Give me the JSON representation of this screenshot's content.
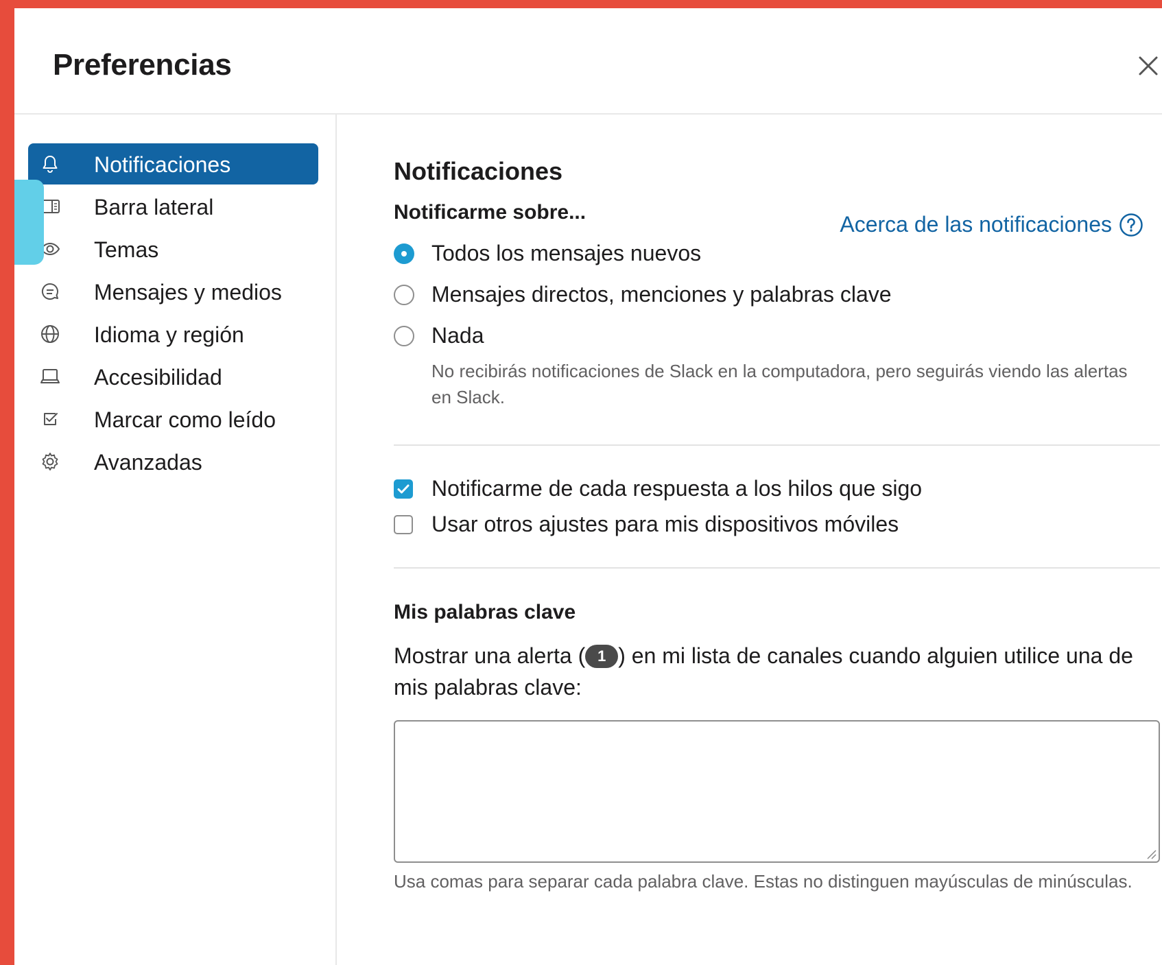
{
  "dialog": {
    "title": "Preferencias"
  },
  "sidebar": {
    "items": [
      {
        "label": "Notificaciones",
        "icon": "bell-icon",
        "active": true
      },
      {
        "label": "Barra lateral",
        "icon": "sidebar-icon",
        "active": false
      },
      {
        "label": "Temas",
        "icon": "eye-icon",
        "active": false
      },
      {
        "label": "Mensajes y medios",
        "icon": "message-icon",
        "active": false
      },
      {
        "label": "Idioma y región",
        "icon": "globe-icon",
        "active": false
      },
      {
        "label": "Accesibilidad",
        "icon": "laptop-icon",
        "active": false
      },
      {
        "label": "Marcar como leído",
        "icon": "check-square-icon",
        "active": false
      },
      {
        "label": "Avanzadas",
        "icon": "gear-icon",
        "active": false
      }
    ]
  },
  "main": {
    "section_title": "Notificaciones",
    "notify_heading": "Notificarme sobre...",
    "about_link": "Acerca de las notificaciones",
    "radio_options": [
      {
        "label": "Todos los mensajes nuevos",
        "checked": true
      },
      {
        "label": "Mensajes directos, menciones y palabras clave",
        "checked": false
      },
      {
        "label": "Nada",
        "checked": false
      }
    ],
    "nothing_helper": "No recibirás notificaciones de Slack en la computadora, pero seguirás viendo las alertas en Slack.",
    "checkboxes": [
      {
        "label": "Notificarme de cada respuesta a los hilos que sigo",
        "checked": true
      },
      {
        "label": "Usar otros ajustes para mis dispositivos móviles",
        "checked": false
      }
    ],
    "keywords_heading": "Mis palabras clave",
    "keywords_desc_before": "Mostrar una alerta (",
    "keywords_badge": "1",
    "keywords_desc_after": ") en mi lista de canales cuando alguien utilice una de mis palabras clave:",
    "keywords_value": "",
    "keywords_hint": "Usa comas para separar cada palabra clave. Estas no distinguen mayúsculas de minúsculas."
  },
  "colors": {
    "frame": "#e74c3c",
    "accent": "#1264a3",
    "checkbox_blue": "#1d9bd1",
    "marker": "#62cfe8"
  }
}
